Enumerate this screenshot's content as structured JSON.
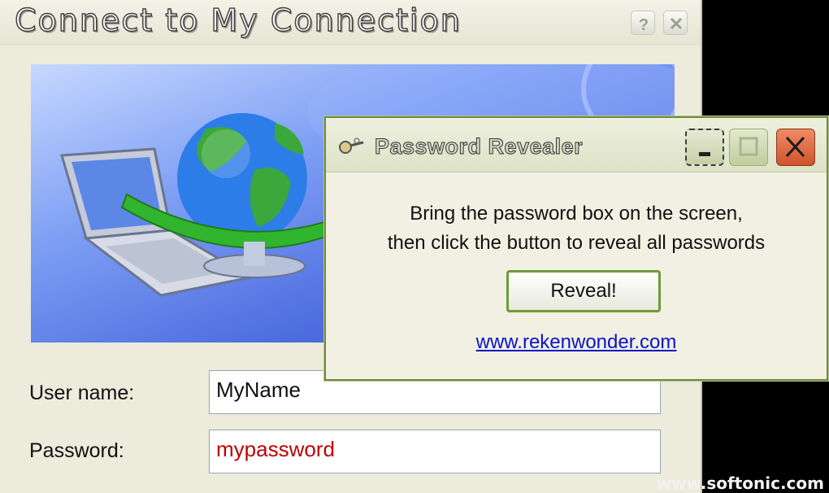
{
  "connect_dialog": {
    "title": "Connect to My Connection",
    "username_label": "User name:",
    "username_value": "MyName",
    "password_label": "Password:",
    "password_value": "mypassword",
    "password_color": "#c00000"
  },
  "revealer": {
    "title": "Password Revealer",
    "instruction_line1": "Bring the password box on the screen,",
    "instruction_line2": "then click the button to reveal all passwords",
    "reveal_label": "Reveal!",
    "link_text": "www.rekenwonder.com",
    "accent_color": "#6f9a3a",
    "close_color": "#d0532c"
  },
  "watermark": "www.softonic.com",
  "icons": [
    "help-icon",
    "close-icon",
    "minimize-icon",
    "maximize-icon",
    "app-icon",
    "globe-laptop-illustration"
  ]
}
